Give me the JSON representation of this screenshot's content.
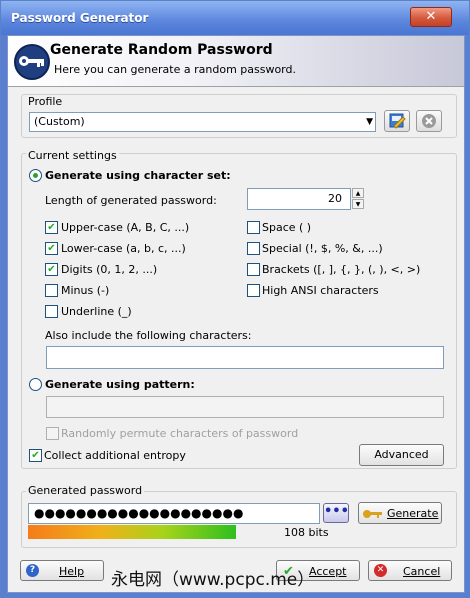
{
  "window": {
    "title": "Password Generator",
    "close_glyph": "✕"
  },
  "header": {
    "title": "Generate Random Password",
    "subtitle": "Here you can generate a random password.",
    "icon": "key-icon"
  },
  "profile": {
    "label": "Profile",
    "value": "(Custom)"
  },
  "settings": {
    "label": "Current settings",
    "charset_radio_label": "Generate using character set:",
    "charset_selected": true,
    "length_label": "Length of generated password:",
    "length_value": "20",
    "options": [
      {
        "label": "Upper-case (A, B, C, ...)",
        "checked": true
      },
      {
        "label": "Space ( )",
        "checked": false
      },
      {
        "label": "Lower-case (a, b, c, ...)",
        "checked": true
      },
      {
        "label": "Special (!, $, %, &, ...)",
        "checked": false
      },
      {
        "label": "Digits (0, 1, 2, ...)",
        "checked": true
      },
      {
        "label": "Brackets ([, ], {, }, (, ), <, >)",
        "checked": false
      },
      {
        "label": "Minus (-)",
        "checked": false
      },
      {
        "label": "High ANSI characters",
        "checked": false
      },
      {
        "label": "Underline (_)",
        "checked": false
      }
    ],
    "include_label": "Also include the following characters:",
    "include_value": "",
    "pattern_radio_label": "Generate using pattern:",
    "pattern_value": "",
    "permute_label": "Randomly permute characters of password",
    "entropy_label": "Collect additional entropy",
    "entropy_checked": true,
    "advanced_label": "Advanced"
  },
  "generated": {
    "label": "Generated password",
    "masked_value": "●●●●●●●●●●●●●●●●●●●●",
    "reveal_glyph": "•••",
    "generate_label": "Generate",
    "quality_bits": "108 bits",
    "quality_fraction": 0.72
  },
  "footer": {
    "help_label": "Help",
    "accept_label": "Accept",
    "cancel_label": "Cancel"
  },
  "watermark": "永电网（www.pcpc.me）",
  "colors": {
    "titlebar": "#5c86dd",
    "accent_check": "#22aa22",
    "close": "#d65a3e"
  }
}
